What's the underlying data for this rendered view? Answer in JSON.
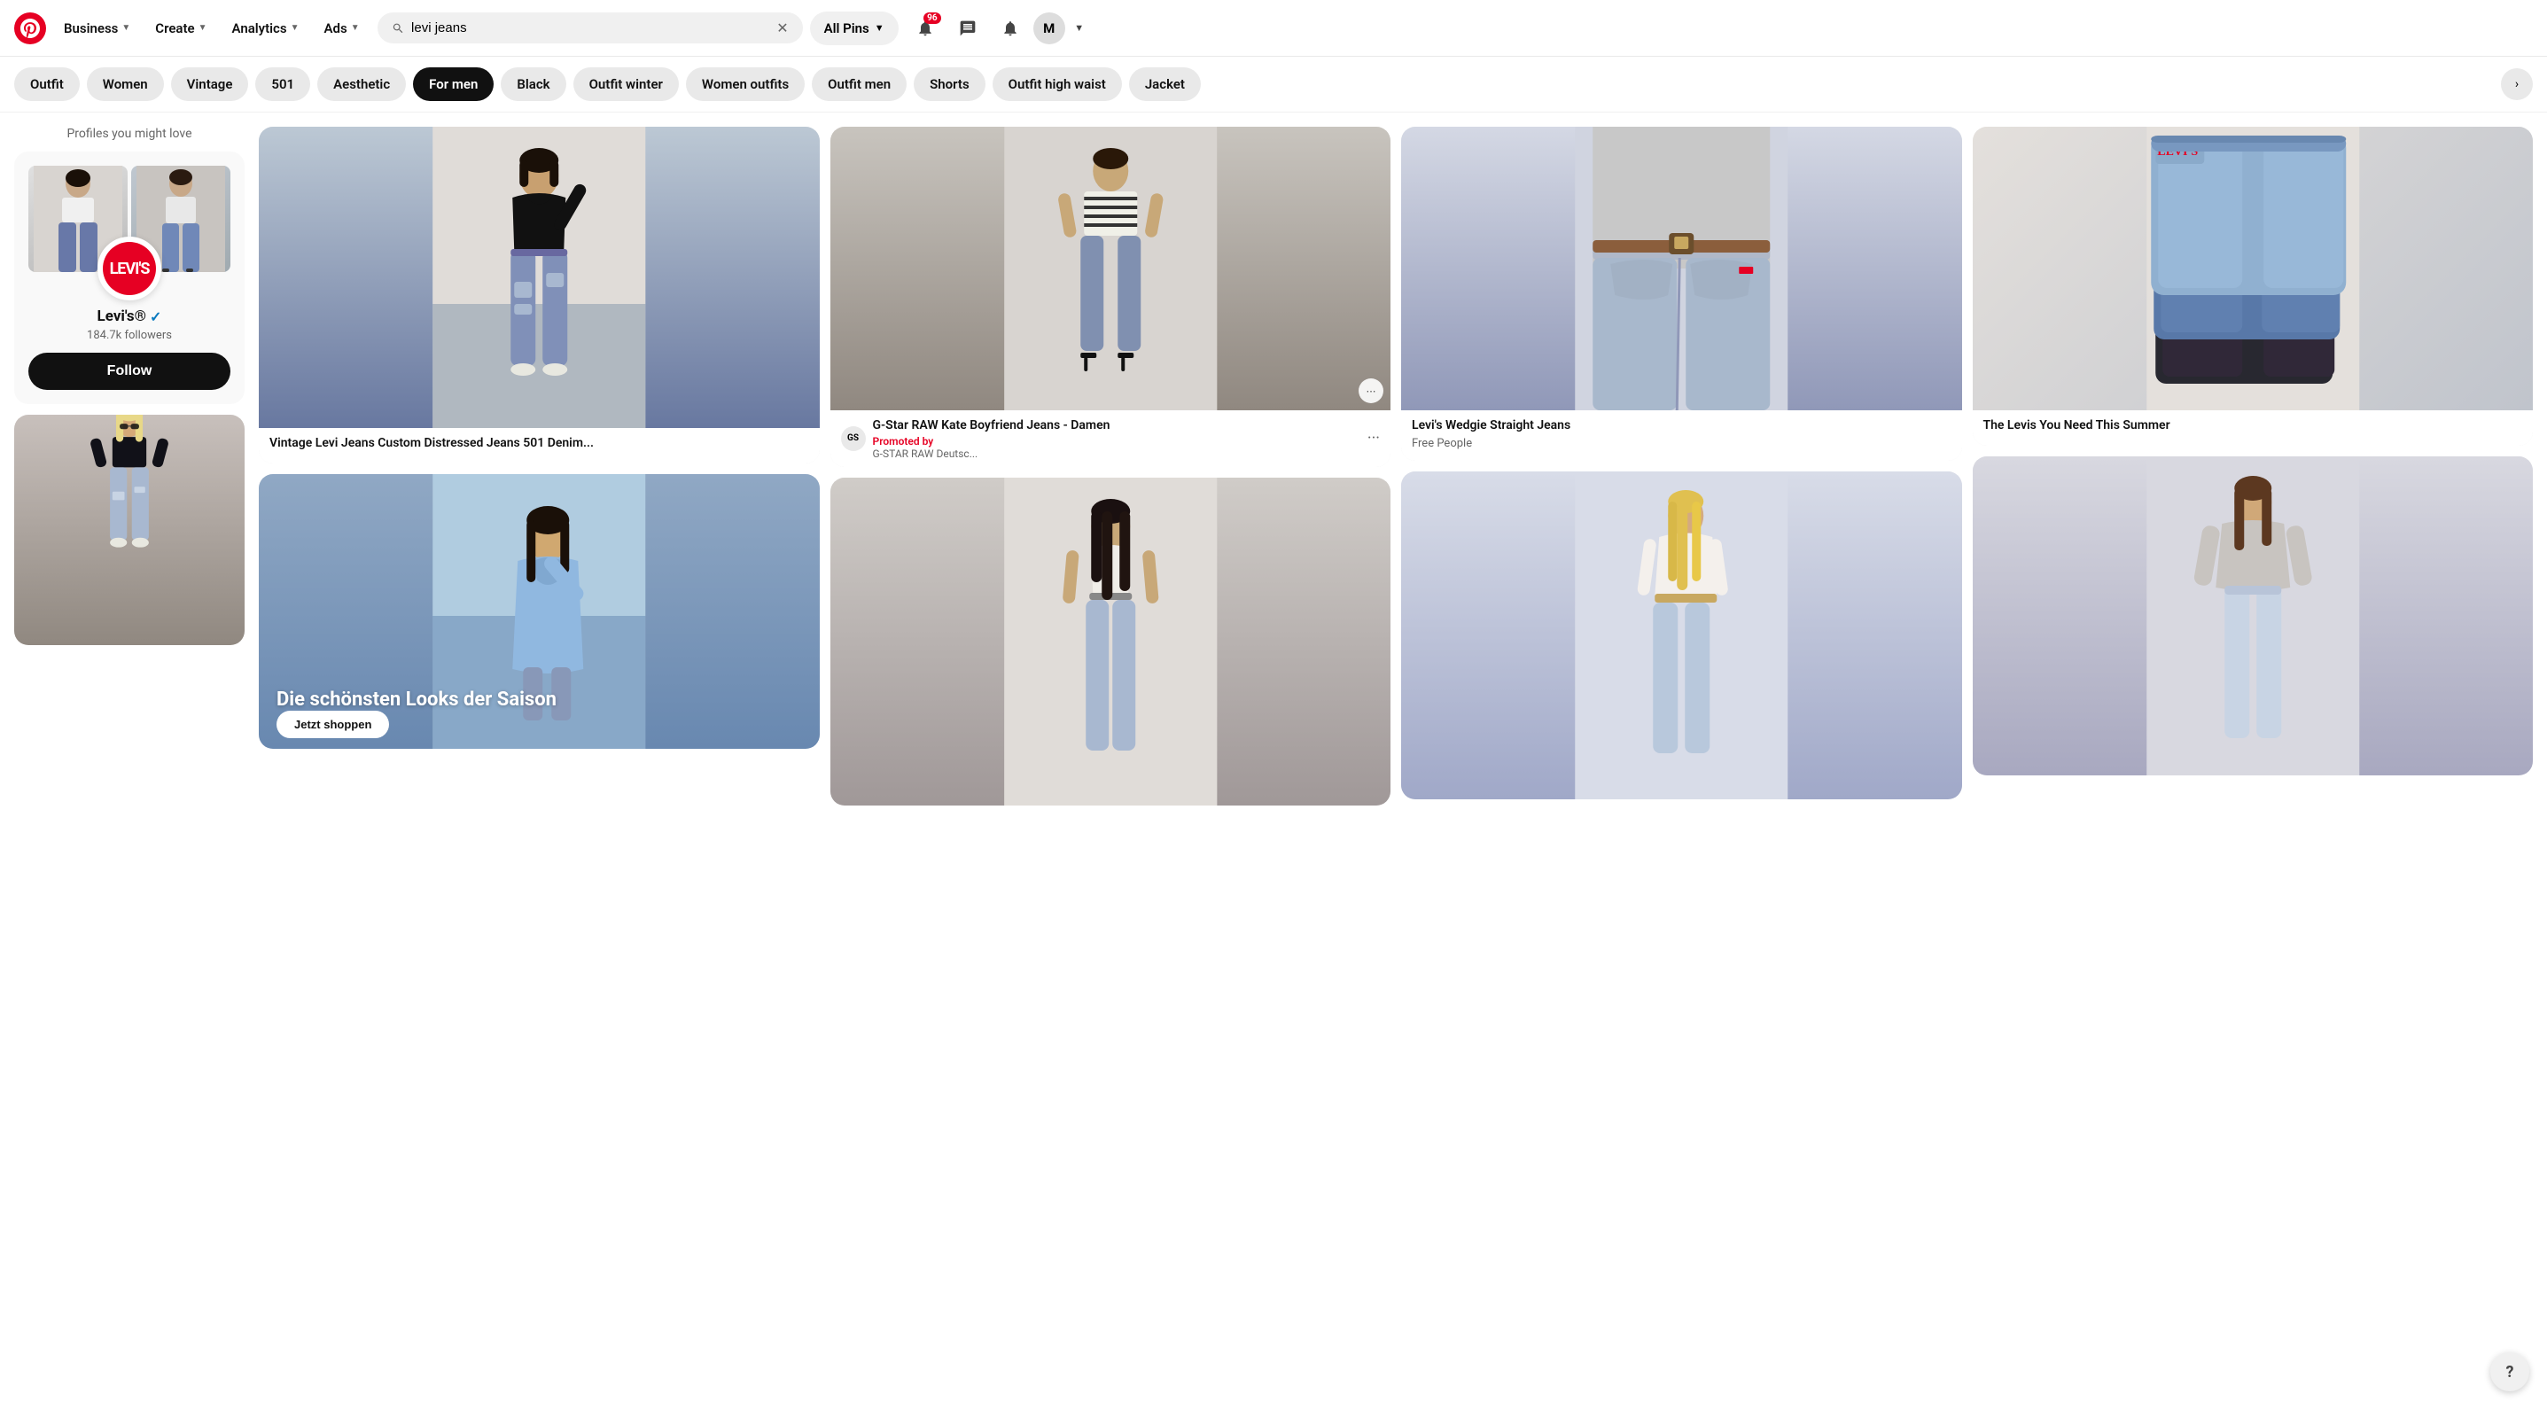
{
  "header": {
    "logo_letter": "P",
    "nav": [
      {
        "id": "business",
        "label": "Business",
        "has_chevron": true
      },
      {
        "id": "create",
        "label": "Create",
        "has_chevron": true
      },
      {
        "id": "analytics",
        "label": "Analytics",
        "has_chevron": true
      },
      {
        "id": "ads",
        "label": "Ads",
        "has_chevron": true
      }
    ],
    "search_value": "levi jeans",
    "all_pins_label": "All Pins",
    "notif_count": "96",
    "avatar_letter": "M"
  },
  "filter_pills": [
    {
      "id": "outfit",
      "label": "Outfit",
      "active": false
    },
    {
      "id": "women",
      "label": "Women",
      "active": false
    },
    {
      "id": "vintage",
      "label": "Vintage",
      "active": false
    },
    {
      "id": "501",
      "label": "501",
      "active": false
    },
    {
      "id": "aesthetic",
      "label": "Aesthetic",
      "active": false
    },
    {
      "id": "for-men",
      "label": "For men",
      "active": true
    },
    {
      "id": "black",
      "label": "Black",
      "active": false
    },
    {
      "id": "outfit-winter",
      "label": "Outfit winter",
      "active": false
    },
    {
      "id": "women-outfits",
      "label": "Women outfits",
      "active": false
    },
    {
      "id": "outfit-men",
      "label": "Outfit men",
      "active": false
    },
    {
      "id": "shorts",
      "label": "Shorts",
      "active": false
    },
    {
      "id": "outfit-high-waist",
      "label": "Outfit high waist",
      "active": false
    },
    {
      "id": "jacket",
      "label": "Jacket",
      "active": false
    }
  ],
  "sidebar": {
    "profiles_title": "Profiles you might love",
    "profile": {
      "name": "Levi's®",
      "verified": true,
      "followers": "184.7k followers",
      "follow_label": "Follow"
    }
  },
  "grid": {
    "items": [
      {
        "id": "vintage-jeans",
        "title": "Vintage Levi Jeans Custom Distressed Jeans 501 Denim...",
        "type": "pin"
      },
      {
        "id": "gstar-jeans",
        "title": "G-Star RAW Kate Boyfriend Jeans - Damen",
        "type": "promoted",
        "promoted_by": "Promoted by",
        "source": "G-STAR RAW Deutsc..."
      },
      {
        "id": "levis-wedgie",
        "title": "Levi's Wedgie Straight Jeans",
        "source": "Free People",
        "type": "pin"
      },
      {
        "id": "levis-summer",
        "title": "The Levis You Need This Summer",
        "type": "pin"
      }
    ]
  },
  "help": {
    "label": "?"
  }
}
